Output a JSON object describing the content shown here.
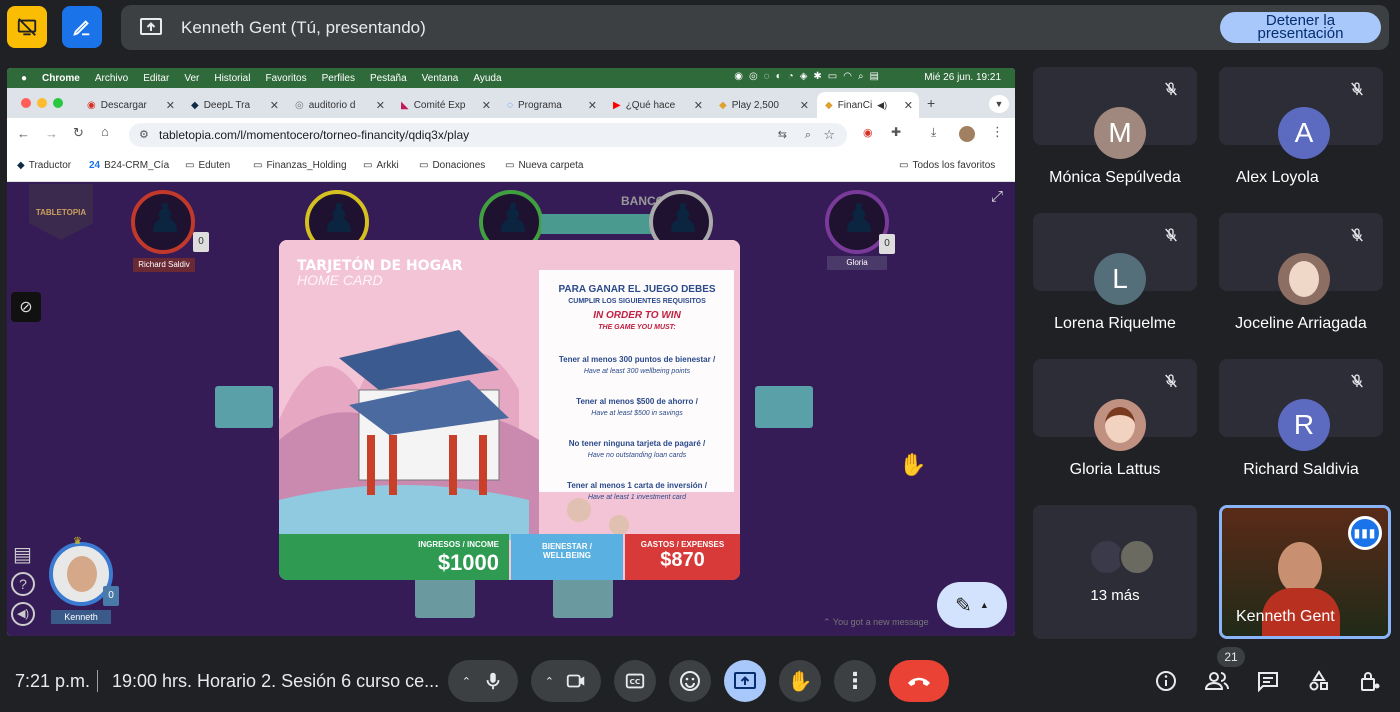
{
  "meet": {
    "presenting_label": "Kenneth Gent (Tú, presentando)",
    "stop_label_line1": "Detener la",
    "stop_label_line2": "presentación",
    "clock": "7:21 p.m.",
    "meeting_title": "19:00 hrs. Horario 2. Sesión 6 curso ce...",
    "participants_badge": "21",
    "more_count": "13 más",
    "colors": {
      "background": "#202124",
      "tile": "#3c4043",
      "accent": "#a8c7fa",
      "leave": "#ea4335",
      "active_border": "#8ab4f8",
      "toolbar_yellow": "#fbbc04",
      "toolbar_blue": "#1a73e8"
    }
  },
  "participants": [
    {
      "name": "Mónica Sepúlveda",
      "initial": "M",
      "color": "#a1887f"
    },
    {
      "name": "Alex Loyola",
      "initial": "A",
      "color": "#5c6bc0"
    },
    {
      "name": "Lorena Riquelme",
      "initial": "L",
      "color": "#546e7a"
    },
    {
      "name": "Joceline Arriagada",
      "initial": "",
      "color": "#8d6e63"
    },
    {
      "name": "Gloria Lattus",
      "initial": "",
      "color": "#c09080"
    },
    {
      "name": "Richard Saldivia",
      "initial": "R",
      "color": "#5c6bc0"
    },
    {
      "name": "Kenneth Gent",
      "initial": "",
      "color": "#3a2418"
    }
  ],
  "mac": {
    "menu": [
      "Chrome",
      "Archivo",
      "Editar",
      "Ver",
      "Historial",
      "Favoritos",
      "Perfiles",
      "Pestaña",
      "Ventana",
      "Ayuda"
    ],
    "datetime": "Mié 26 jun.  19:21"
  },
  "browser": {
    "tabs": [
      "Descargar",
      "DeepL Tra",
      "auditorio d",
      "Comité Exp",
      "Programa",
      "¿Qué hace",
      "Play 2,500",
      "FinanCi"
    ],
    "url": "tabletopia.com/l/momentocero/torneo-financity/qdiq3x/play",
    "bookmarks": [
      "Traductor",
      "B24-CRM_Cía",
      "Eduten",
      "Finanzas_Holding",
      "Arkki",
      "Donaciones",
      "Nueva carpeta"
    ],
    "all_bookmarks": "Todos los favoritos"
  },
  "game": {
    "logo": "TABLETOPIA",
    "bank": "BANCO",
    "players": [
      {
        "name": "Richard Saldiv",
        "count": "0"
      },
      {
        "name": "Gloria",
        "count": "0"
      },
      {
        "name": "Kenneth",
        "count": "0"
      }
    ],
    "card": {
      "title_es": "TARJETÓN DE HOGAR",
      "title_en": "HOME CARD",
      "win_es_1": "PARA GANAR EL JUEGO DEBES",
      "win_es_2": "CUMPLIR LOS SIGUIENTES REQUISITOS",
      "win_en_1": "IN ORDER TO WIN",
      "win_en_2": "THE GAME YOU MUST:",
      "requirements": [
        {
          "es": "Tener al menos 300 puntos de bienestar /",
          "en": "Have at least 300 wellbeing points"
        },
        {
          "es": "Tener al menos $500 de ahorro /",
          "en": "Have at least $500 in savings"
        },
        {
          "es": "No tener ninguna tarjeta de pagaré /",
          "en": "Have no outstanding loan cards"
        },
        {
          "es": "Tener al menos 1 carta de inversión /",
          "en": "Have at least 1 investment card"
        }
      ],
      "income_label": "INGRESOS / INCOME",
      "income_value": "$1000",
      "wellbeing_label_1": "BIENESTAR /",
      "wellbeing_label_2": "WELLBEING",
      "expenses_label": "GASTOS / EXPENSES",
      "expenses_value": "$870"
    },
    "toast": "You got a new message"
  }
}
